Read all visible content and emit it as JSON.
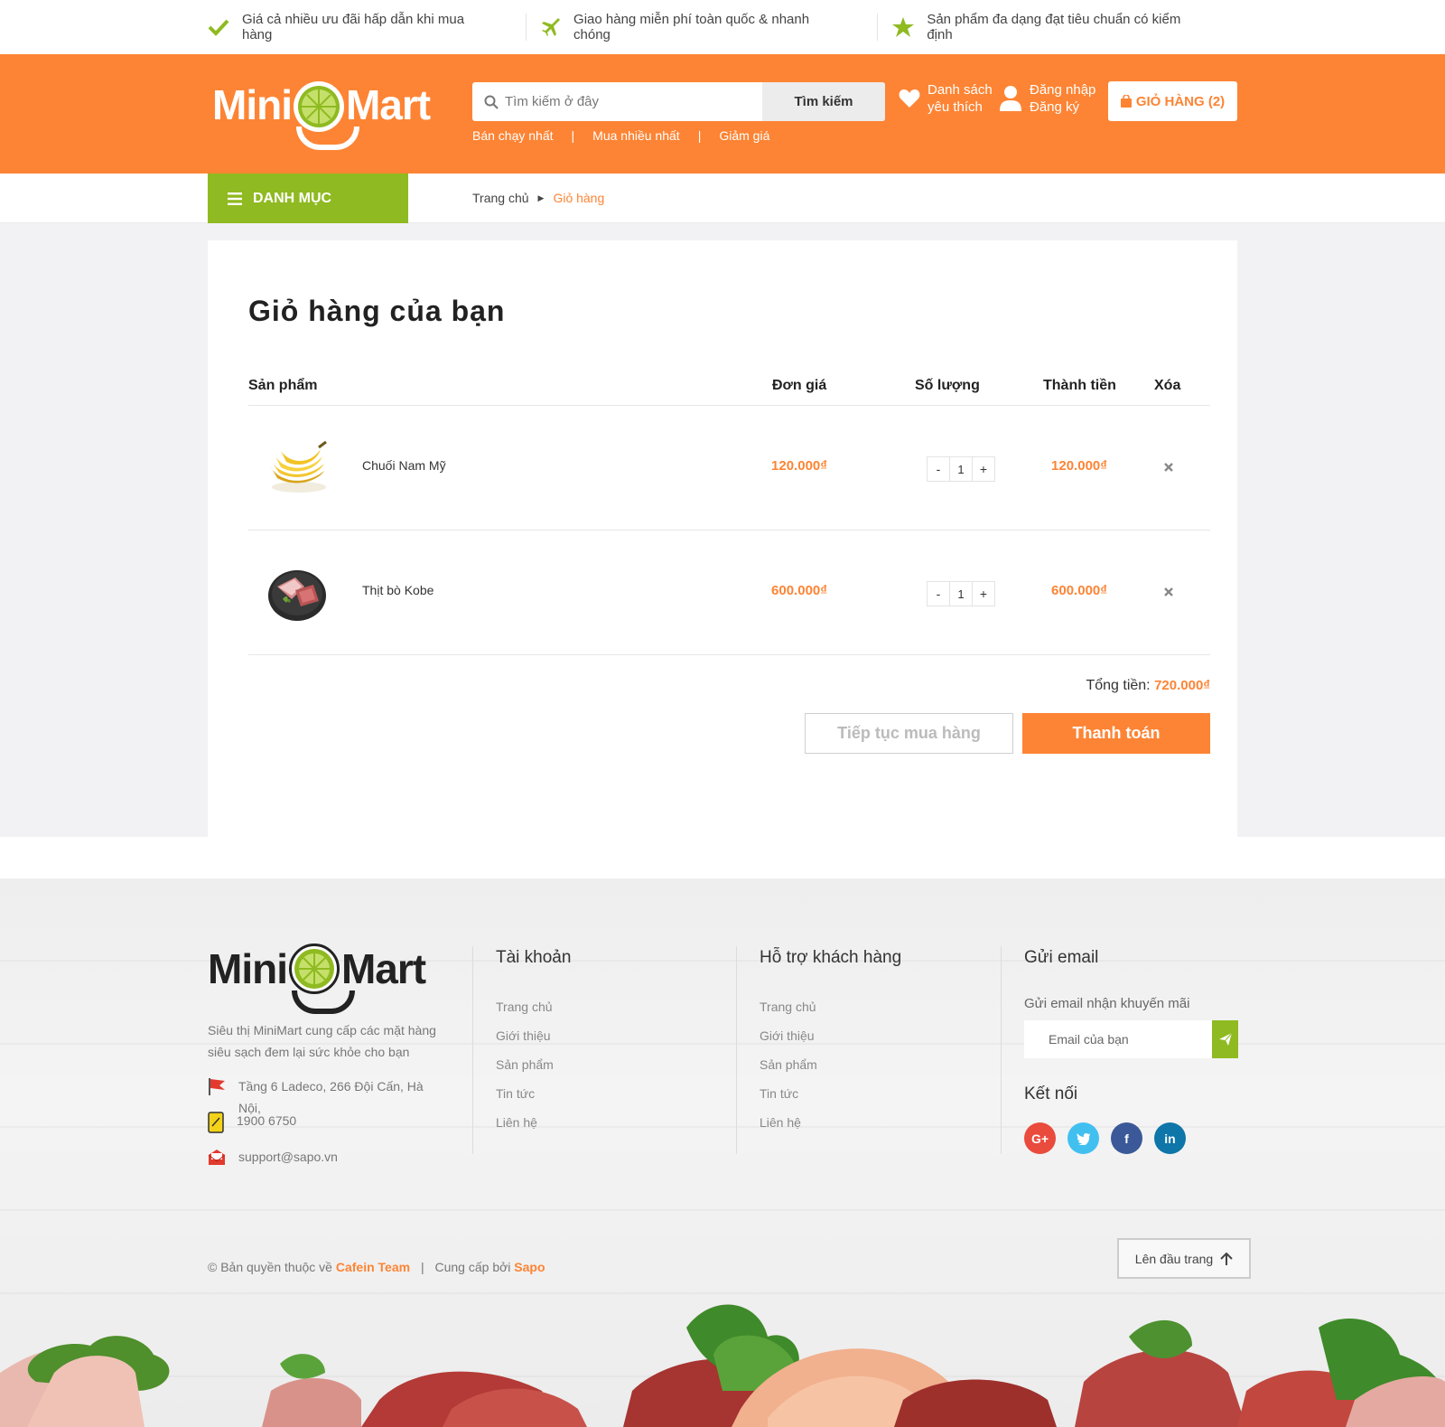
{
  "topbar": {
    "perks": [
      {
        "icon": "check-icon",
        "text": "Giá cả nhiều ưu đãi hấp dẫn khi mua hàng"
      },
      {
        "icon": "airplane-icon",
        "text": "Giao hàng miễn phí toàn quốc & nhanh chóng"
      },
      {
        "icon": "star-icon",
        "text": "Sản phẩm đa dạng đạt tiêu chuẩn có kiểm định"
      }
    ]
  },
  "header": {
    "logo_left": "Mini",
    "logo_right": "Mart",
    "search_placeholder": "Tìm kiếm ở đây",
    "search_button": "Tìm kiếm",
    "quicklinks": [
      "Bán chạy nhất",
      "Mua nhiều nhất",
      "Giảm giá"
    ],
    "quicklink_sep": "|",
    "wishlist_line1": "Danh sách",
    "wishlist_line2": "yêu thích",
    "login": "Đăng nhập",
    "register": "Đăng ký",
    "cart": "GIỎ HÀNG (2)",
    "brand_color": "#fd8434",
    "accent_green": "#8fba21"
  },
  "nav": {
    "category": "DANH MỤC",
    "breadcrumb_home": "Trang chủ",
    "breadcrumb_current": "Giỏ hàng"
  },
  "cart": {
    "title": "Giỏ hàng của bạn",
    "columns": {
      "product": "Sản phẩm",
      "unit_price": "Đơn giá",
      "quantity": "Số lượng",
      "line_total": "Thành tiền",
      "remove": "Xóa"
    },
    "items": [
      {
        "name": "Chuối Nam Mỹ",
        "price": "120.000₫",
        "qty": "1",
        "total": "120.000₫",
        "image": "banana-image"
      },
      {
        "name": "Thịt bò Kobe",
        "price": "600.000₫",
        "qty": "1",
        "total": "600.000₫",
        "image": "beef-image"
      }
    ],
    "qty_minus": "-",
    "qty_plus": "+",
    "sum_label": "Tổng tiền:",
    "sum_value": "720.000₫",
    "continue_button": "Tiếp tục mua hàng",
    "checkout_button": "Thanh toán"
  },
  "footer": {
    "logo_left": "Mini",
    "logo_right": "Mart",
    "description": "Siêu thị MiniMart cung cấp các mặt hàng siêu sạch đem lại sức khỏe cho bạn",
    "address": "Tầng 6 Ladeco, 266 Đội Cấn, Hà Nội,",
    "phone": "1900 6750",
    "email": "support@sapo.vn",
    "account_title": "Tài khoản",
    "account_links": [
      "Trang chủ",
      "Giới thiệu",
      "Sản phẩm",
      "Tin tức",
      "Liên hệ"
    ],
    "support_title": "Hỗ trợ khách hàng",
    "support_links": [
      "Trang chủ",
      "Giới thiệu",
      "Sản phẩm",
      "Tin tức",
      "Liên hệ"
    ],
    "email_title": "Gửi email",
    "email_sub": "Gửi email nhận khuyến mãi",
    "email_placeholder": "Email của bạn",
    "connect_title": "Kết nối",
    "social": [
      {
        "icon": "google-plus-icon",
        "label": "G+",
        "color": "#e94b3c"
      },
      {
        "icon": "twitter-icon",
        "label": "t",
        "color": "#41c0f0"
      },
      {
        "icon": "facebook-icon",
        "label": "f",
        "color": "#3b5998"
      },
      {
        "icon": "linkedin-icon",
        "label": "in",
        "color": "#0e76a8"
      }
    ],
    "copyright_prefix": "© Bản quyền thuộc về",
    "copyright_team": "Cafein Team",
    "copyright_sep": "|",
    "provided_by": "Cung cấp bởi",
    "provider": "Sapo",
    "back_to_top": "Lên đầu trang"
  }
}
